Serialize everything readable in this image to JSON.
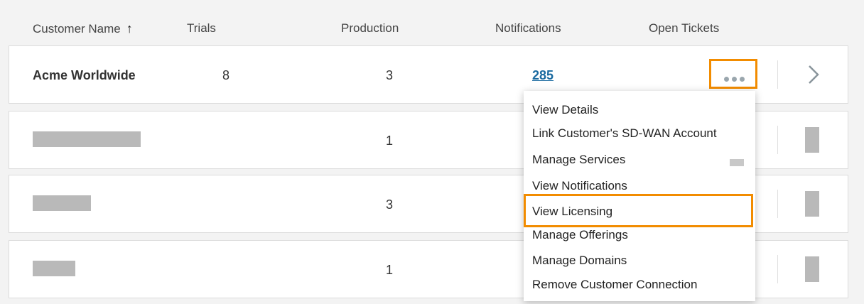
{
  "header": {
    "customer_name": "Customer Name",
    "sort_arrow": "↑",
    "trials": "Trials",
    "production": "Production",
    "notifications": "Notifications",
    "open_tickets": "Open Tickets"
  },
  "rows": [
    {
      "name": "Acme Worldwide",
      "trials": "8",
      "production": "3",
      "notifications": "285"
    },
    {
      "name": "",
      "trials": "",
      "production": "1",
      "notifications": ""
    },
    {
      "name": "",
      "trials": "",
      "production": "3",
      "notifications": ""
    },
    {
      "name": "",
      "trials": "",
      "production": "1",
      "notifications": ""
    }
  ],
  "menu": {
    "items": [
      "View Details",
      "Link Customer's SD-WAN Account",
      "Manage Services",
      "View Notifications",
      "View Licensing",
      "Manage Offerings",
      "Manage Domains",
      "Remove Customer Connection"
    ],
    "highlighted": "View Licensing"
  },
  "icons": {
    "more": "more-horizontal-icon",
    "chevron": "chevron-right-icon"
  },
  "colors": {
    "accent": "#f28c00",
    "link": "#1a6aa0",
    "redacted": "#b9b9b9"
  }
}
